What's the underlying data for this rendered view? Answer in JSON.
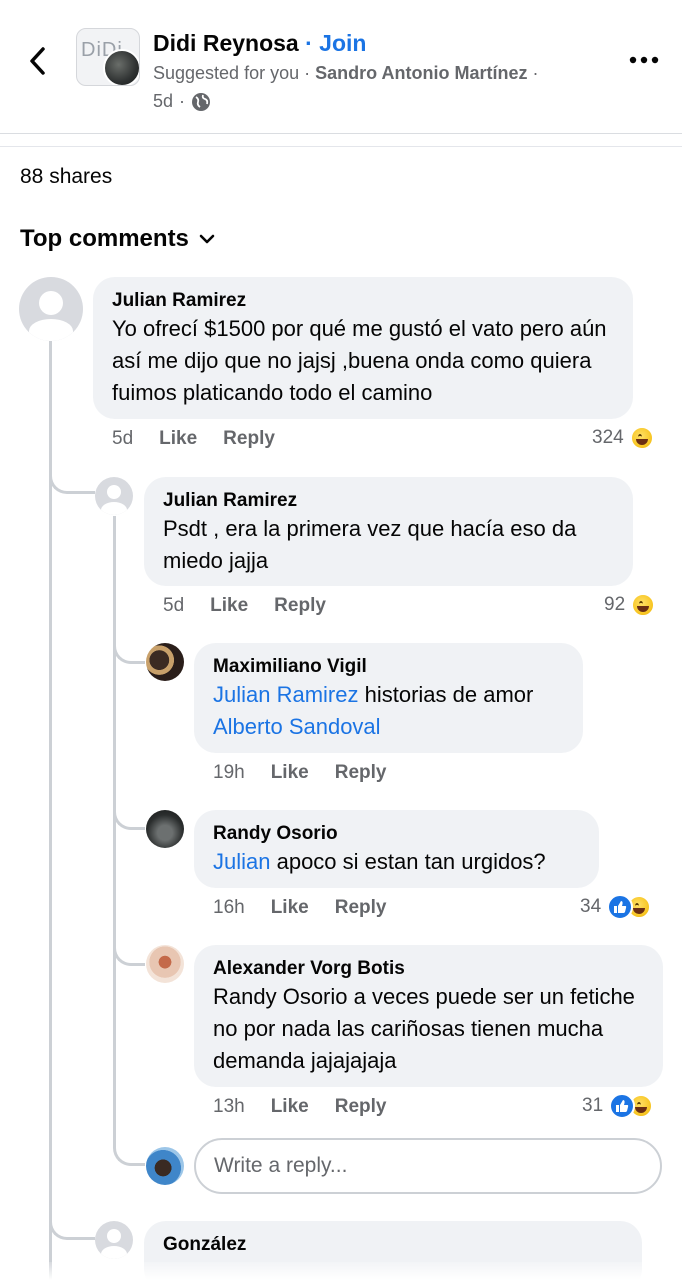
{
  "header": {
    "group_name": "Didi Reynosa",
    "separator": "·",
    "join_label": "Join",
    "suggested": "Suggested for you",
    "author": "Sandro Antonio Martínez",
    "dot": "·",
    "time": "5d",
    "avatar_text": "DiDi"
  },
  "post": {
    "shares": "88 shares",
    "sort_label": "Top comments"
  },
  "comments": [
    {
      "name": "Julian Ramirez",
      "text": "Yo ofrecí $1500 por qué me gustó el vato pero aún así me dijo que no jajsj ,buena onda como quiera fuimos platicando todo el camino",
      "time": "5d",
      "like": "Like",
      "reply": "Reply",
      "reactions": "324",
      "reaction_icons": [
        "haha-icon"
      ]
    },
    {
      "name": "Julian Ramirez",
      "text": "Psdt , era la primera vez que hacía eso da miedo jajja",
      "time": "5d",
      "like": "Like",
      "reply": "Reply",
      "reactions": "92",
      "reaction_icons": [
        "haha-icon"
      ]
    },
    {
      "name": "Maximiliano Vigil",
      "mention1": "Julian Ramirez",
      "text": " historias de amor",
      "mention2": "Alberto Sandoval",
      "time": "19h",
      "like": "Like",
      "reply": "Reply"
    },
    {
      "name": "Randy Osorio",
      "mention1": "Julian",
      "text": " apoco si estan tan urgidos?",
      "time": "16h",
      "like": "Like",
      "reply": "Reply",
      "reactions": "34",
      "reaction_icons": [
        "like-icon",
        "haha-icon"
      ]
    },
    {
      "name": "Alexander Vorg Botis",
      "text": "Randy Osorio a veces puede ser un fetiche no por nada las cariñosas tienen mucha demanda jajajajaja",
      "time": "13h",
      "like": "Like",
      "reply": "Reply",
      "reactions": "31",
      "reaction_icons": [
        "like-icon",
        "haha-icon"
      ]
    },
    {
      "name": "González"
    }
  ],
  "reply_box": {
    "placeholder": "Write a reply..."
  },
  "colors": {
    "link": "#1b74e4",
    "bubble": "#f0f2f5",
    "secondary_text": "#65676b",
    "thread_line": "#ccd0d5"
  }
}
